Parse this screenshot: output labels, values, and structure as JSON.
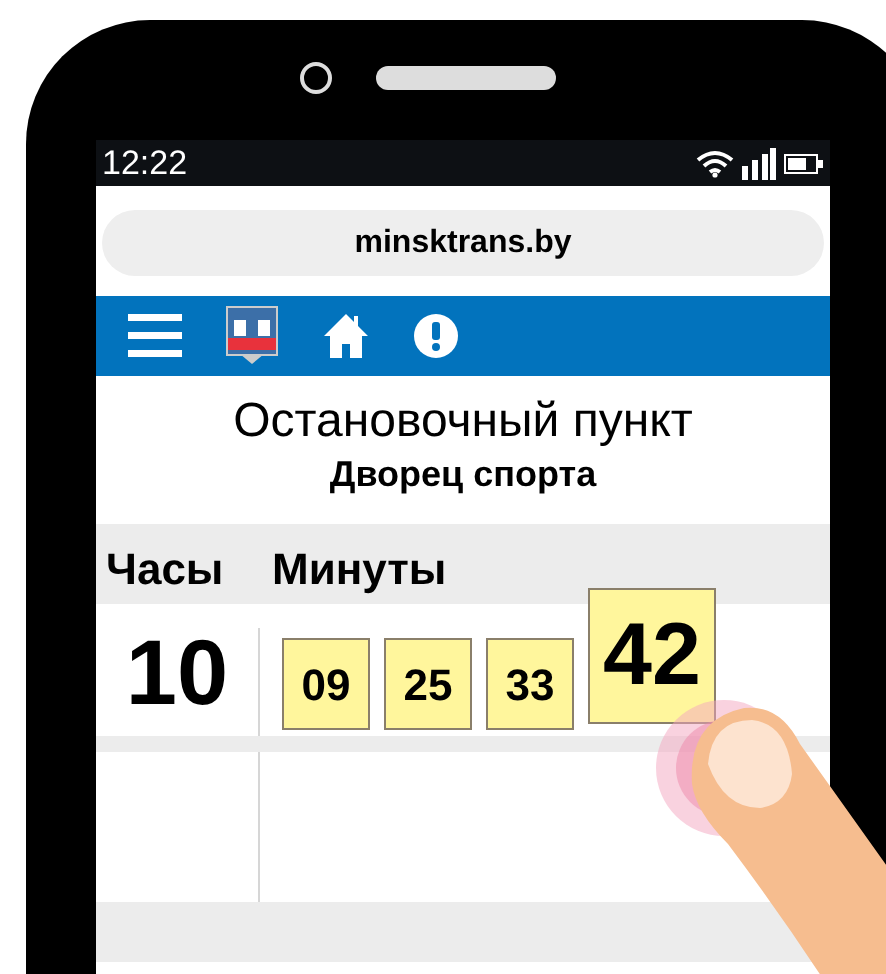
{
  "status_bar": {
    "time": "12:22"
  },
  "address_bar": {
    "url": "minsktrans.by"
  },
  "stop": {
    "label": "Остановочный пункт",
    "name": "Дворец спорта"
  },
  "timetable": {
    "columns": [
      "Часы",
      "Минуты"
    ],
    "rows": [
      {
        "hour": "10",
        "minutes": [
          {
            "text": "09",
            "selected": false
          },
          {
            "text": "25",
            "selected": false
          },
          {
            "text": "33",
            "selected": false
          },
          {
            "text": "42",
            "selected": true
          }
        ]
      }
    ]
  }
}
